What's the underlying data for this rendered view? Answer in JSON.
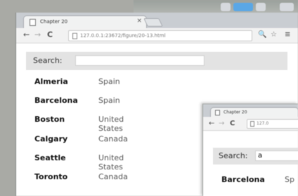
{
  "main_window": {
    "tab": {
      "title": "Chapter 20",
      "close": "×"
    },
    "toolbar": {
      "back": "←",
      "forward": "→",
      "reload": "C",
      "url": "127.0.0.1:23672/figure/20-13.html",
      "zoom_icon": "🔍",
      "star_icon": "☆",
      "menu_icon": "≡"
    },
    "search": {
      "label": "Search:",
      "value": ""
    },
    "cities": [
      {
        "city": "Almeria",
        "country": "Spain"
      },
      {
        "city": "Barcelona",
        "country": "Spain"
      },
      {
        "city": "Boston",
        "country": "United States"
      },
      {
        "city": "Calgary",
        "country": "Canada"
      },
      {
        "city": "Seattle",
        "country": "United States"
      },
      {
        "city": "Toronto",
        "country": "Canada"
      }
    ]
  },
  "second_window": {
    "tab": {
      "title": "Chapter 20"
    },
    "toolbar": {
      "back": "←",
      "forward": "→",
      "reload": "C",
      "url": "127.0"
    },
    "search": {
      "label": "Search:",
      "value": "a"
    },
    "cities": [
      {
        "city": "Barcelona",
        "country": "Sp"
      }
    ]
  }
}
